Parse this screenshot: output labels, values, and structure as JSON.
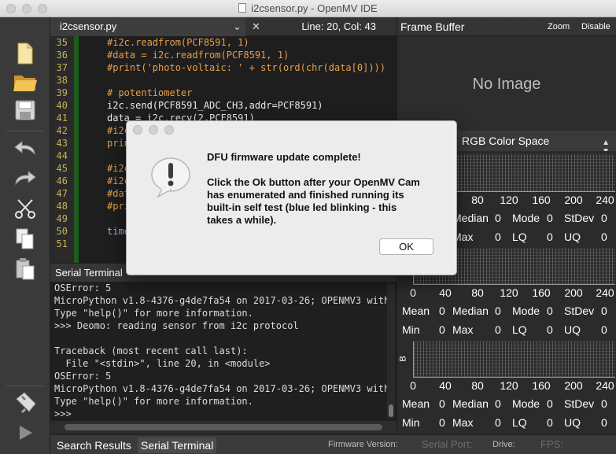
{
  "window": {
    "title": "i2csensor.py - OpenMV IDE"
  },
  "editor": {
    "tab_name": "i2csensor.py",
    "tab_dropdown_icon": "chevron-down-icon",
    "tab_close_icon": "close-icon",
    "cursor_position": "Line: 20, Col: 43",
    "lines": [
      {
        "n": "35",
        "text": "#i2c.readfrom(PCF8591, 1)"
      },
      {
        "n": "36",
        "text": "#data = i2c.readfrom(PCF8591, 1)"
      },
      {
        "n": "37",
        "text": "#print('photo-voltaic: ' + str(ord(chr(data[0])))"
      },
      {
        "n": "38",
        "text": ""
      },
      {
        "n": "39",
        "text": "# potentiometer"
      },
      {
        "n": "40",
        "text": "i2c.send(PCF8591_ADC_CH3,addr=PCF8591)"
      },
      {
        "n": "41",
        "text": "data = i2c.recv(2,PCF8591)"
      },
      {
        "n": "42",
        "text": "#i2c"
      },
      {
        "n": "43",
        "text": "prin"
      },
      {
        "n": "44",
        "text": ""
      },
      {
        "n": "45",
        "text": "#i2c"
      },
      {
        "n": "46",
        "text": "#i2c"
      },
      {
        "n": "47",
        "text": "#dat"
      },
      {
        "n": "48",
        "text": "#pri"
      },
      {
        "n": "49",
        "text": ""
      },
      {
        "n": "50",
        "text": "time"
      },
      {
        "n": "51",
        "text": ""
      }
    ]
  },
  "toolbar": {
    "new_icon": "new-file-icon",
    "open_icon": "open-folder-icon",
    "save_icon": "save-icon",
    "undo_icon": "undo-icon",
    "redo_icon": "redo-icon",
    "cut_icon": "cut-icon",
    "copy_icon": "copy-icon",
    "paste_icon": "paste-icon",
    "connect_icon": "usb-connect-icon",
    "run_icon": "play-icon"
  },
  "terminal": {
    "title": "Serial Terminal",
    "lines": [
      "OSError: 5",
      "MicroPython v1.8-4376-g4de7fa54 on 2017-03-26; OPENMV3 with",
      "Type \"help()\" for more information.",
      ">>> Deomo: reading sensor from i2c protocol",
      "",
      "Traceback (most recent call last):",
      "  File \"<stdin>\", line 20, in <module>",
      "OSError: 5",
      "MicroPython v1.8-4376-g4de7fa54 on 2017-03-26; OPENMV3 with",
      "Type \"help()\" for more information.",
      ">>>"
    ]
  },
  "statusbar": {
    "search_results": "Search Results",
    "serial_terminal": "Serial Terminal",
    "firmware_version": "Firmware Version:",
    "serial_port": "Serial Port:",
    "drive": "Drive:",
    "fps": "FPS:"
  },
  "framebuffer": {
    "title": "Frame Buffer",
    "zoom": "Zoom",
    "disable": "Disable",
    "no_image": "No Image"
  },
  "histogram": {
    "color_space": "RGB Color Space",
    "selector_icon": "updown-arrows-icon",
    "ticks": [
      "0",
      "40",
      "80",
      "120",
      "160",
      "200",
      "240"
    ],
    "channel_b_letter": "B",
    "stat_labels": {
      "mean": "Mean",
      "median": "Median",
      "mode": "Mode",
      "stdev": "StDev",
      "min": "Min",
      "max": "Max",
      "lq": "LQ",
      "uq": "UQ"
    },
    "stat_value": "0"
  },
  "dialog": {
    "title": "DFU firmware update complete!",
    "message": "Click the Ok button after your OpenMV Cam\nhas enumerated and finished running its\nbuilt-in self test (blue led blinking - this\ntakes a while).",
    "ok_button": "OK",
    "icon": "alert-icon"
  }
}
